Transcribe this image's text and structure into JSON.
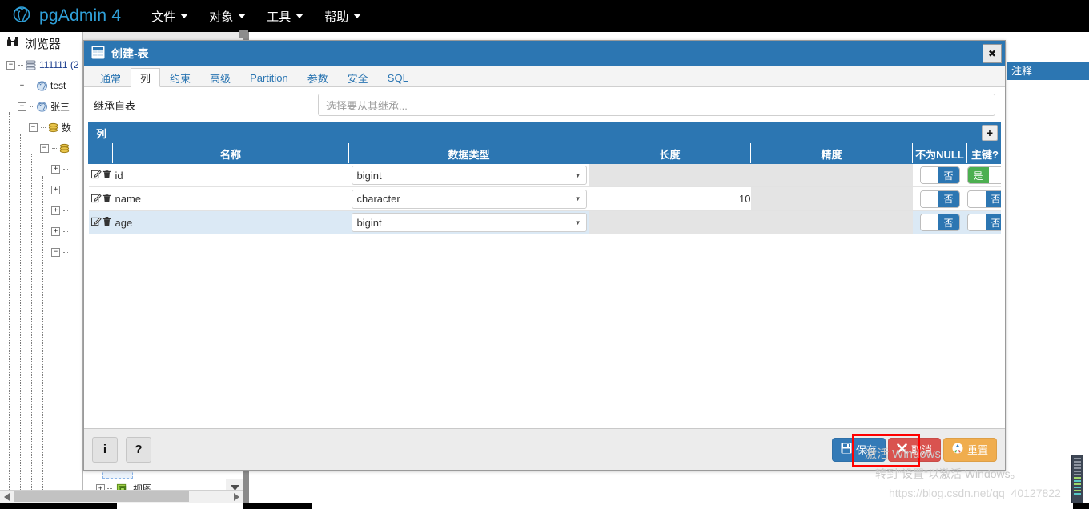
{
  "app": {
    "brand": "pgAdmin 4",
    "logo_icon": "postgres-elephant-icon",
    "menu": [
      {
        "label": "文件",
        "name": "menu-file"
      },
      {
        "label": "对象",
        "name": "menu-object"
      },
      {
        "label": "工具",
        "name": "menu-tools"
      },
      {
        "label": "帮助",
        "name": "menu-help"
      }
    ]
  },
  "browser": {
    "header": "浏览器",
    "header_icon": "binoculars-icon",
    "tree": [
      {
        "label": "111111 (2",
        "icon": "server-group-icon",
        "expander": "-",
        "indent": 0
      },
      {
        "label": "test",
        "icon": "server-icon",
        "expander": "+",
        "indent": 1
      },
      {
        "label": "张三",
        "icon": "server-icon",
        "expander": "-",
        "indent": 1
      },
      {
        "label": "数",
        "icon": "database-icon",
        "expander": "-",
        "indent": 2
      },
      {
        "label": "",
        "icon": "database-icon",
        "expander": "-",
        "indent": 3
      },
      {
        "label": "",
        "icon": "",
        "expander": "+",
        "indent": 4
      },
      {
        "label": "",
        "icon": "",
        "expander": "+",
        "indent": 4
      },
      {
        "label": "",
        "icon": "",
        "expander": "+",
        "indent": 4
      },
      {
        "label": "",
        "icon": "",
        "expander": "+",
        "indent": 4
      },
      {
        "label": "",
        "icon": "",
        "expander": "-",
        "indent": 4
      }
    ],
    "views_node": {
      "label": "视图",
      "icon": "view-icon",
      "expander": "+"
    },
    "scroll_down_icon": "chevron-down-icon",
    "hscroll_left_icon": "chevron-left-icon",
    "hscroll_right_icon": "chevron-right-icon"
  },
  "background": {
    "panel_title": "注释"
  },
  "dialog": {
    "title": "创建-表",
    "title_icon": "table-icon",
    "close_icon": "close-icon",
    "tabs": [
      {
        "label": "通常",
        "name": "tab-general",
        "active": false
      },
      {
        "label": "列",
        "name": "tab-columns",
        "active": true
      },
      {
        "label": "约束",
        "name": "tab-constraints",
        "active": false
      },
      {
        "label": "高级",
        "name": "tab-advanced",
        "active": false
      },
      {
        "label": "Partition",
        "name": "tab-partition",
        "active": false
      },
      {
        "label": "参数",
        "name": "tab-parameters",
        "active": false
      },
      {
        "label": "安全",
        "name": "tab-security",
        "active": false
      },
      {
        "label": "SQL",
        "name": "tab-sql",
        "active": false
      }
    ],
    "inherit": {
      "label": "继承自表",
      "placeholder": "选择要从其继承...",
      "value": ""
    },
    "columns_panel": {
      "title": "列",
      "add_icon": "plus-icon",
      "headers": [
        "",
        "名称",
        "数据类型",
        "长度",
        "精度",
        "不为NULL",
        "主键?"
      ],
      "rows": [
        {
          "name": "id",
          "data_type": "bigint",
          "length": "",
          "precision": "",
          "not_null": "否",
          "not_null_value": false,
          "primary_key": "是",
          "primary_key_value": true,
          "length_disabled": true,
          "precision_disabled": true,
          "selected": false
        },
        {
          "name": "name",
          "data_type": "character",
          "length": "10",
          "precision": "",
          "not_null": "否",
          "not_null_value": false,
          "primary_key": "否",
          "primary_key_value": false,
          "length_disabled": false,
          "precision_disabled": true,
          "selected": false
        },
        {
          "name": "age",
          "data_type": "bigint",
          "length": "",
          "precision": "",
          "not_null": "否",
          "not_null_value": false,
          "primary_key": "否",
          "primary_key_value": false,
          "length_disabled": true,
          "precision_disabled": true,
          "selected": true
        }
      ],
      "row_edit_icon": "edit-pencil-icon",
      "row_delete_icon": "trash-icon",
      "dropdown_icon": "chevron-down-icon"
    },
    "footer": {
      "info_label": "i",
      "help_label": "?",
      "save_label": "保存",
      "save_icon": "floppy-disk-icon",
      "cancel_label": "取消",
      "cancel_icon": "x-icon",
      "reset_label": "重置",
      "reset_icon": "recycle-icon"
    }
  },
  "watermark": {
    "line1": "激活 Windows",
    "line2": "转到\"设置\"以激活 Windows。",
    "url": "https://blog.csdn.net/qq_40127822"
  },
  "colors": {
    "navbar_bg": "#000000",
    "brand_blue": "#2f9fd8",
    "accent_blue": "#2c76b2",
    "button_save": "#337ab7",
    "button_cancel": "#d9534f",
    "button_reset": "#f0ad4e",
    "toggle_yes_green": "#4caf50",
    "row_selected": "#dbe9f5",
    "highlight_red": "#ff0000"
  }
}
